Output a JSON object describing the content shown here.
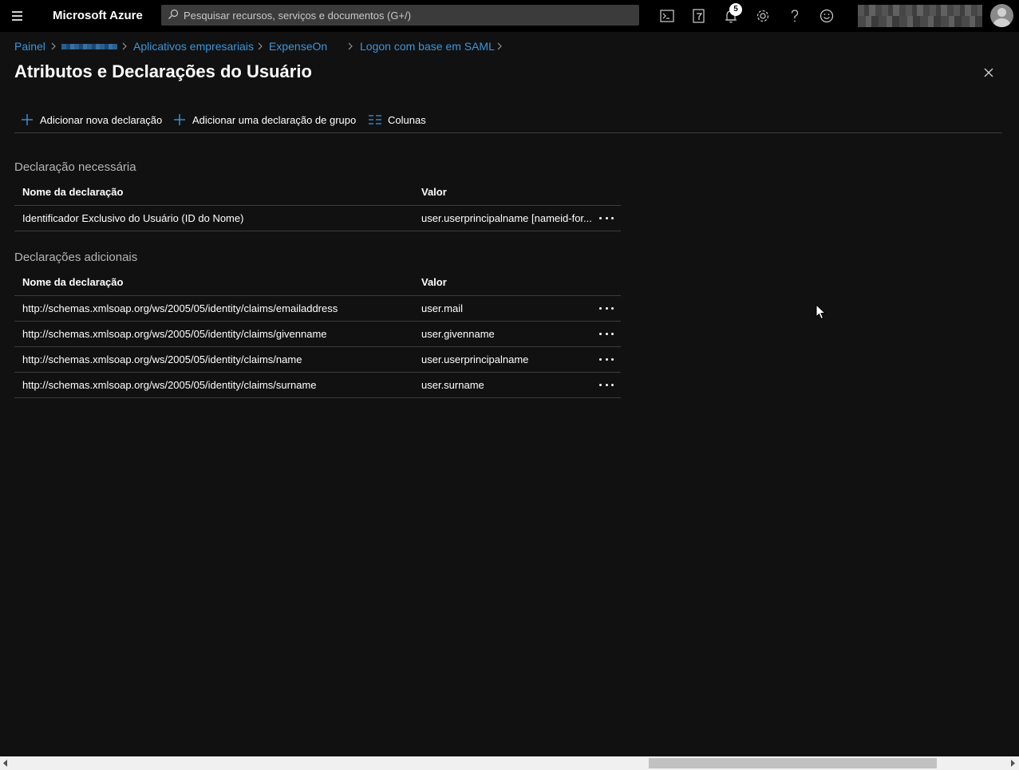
{
  "topbar": {
    "brand": "Microsoft Azure",
    "search_placeholder": "Pesquisar recursos, serviços e documentos (G+/)",
    "notification_count": "5",
    "icons": [
      "cloud-shell-icon",
      "directory-filter-icon",
      "notifications-icon",
      "settings-icon",
      "help-icon",
      "feedback-icon"
    ]
  },
  "breadcrumb": {
    "items": [
      "Painel",
      "Aplicativos empresariais",
      "ExpenseOn",
      "Logon com base em SAML"
    ]
  },
  "page": {
    "title": "Atributos e Declarações do Usuário"
  },
  "toolbar": {
    "add_claim": "Adicionar nova declaração",
    "add_group_claim": "Adicionar uma declaração de grupo",
    "columns": "Colunas"
  },
  "required": {
    "title": "Declaração necessária",
    "col_name": "Nome da declaração",
    "col_value": "Valor",
    "rows": [
      {
        "name": "Identificador Exclusivo do Usuário (ID do Nome)",
        "value": "user.userprincipalname [nameid-for..."
      }
    ]
  },
  "additional": {
    "title": "Declarações adicionais",
    "col_name": "Nome da declaração",
    "col_value": "Valor",
    "rows": [
      {
        "name": "http://schemas.xmlsoap.org/ws/2005/05/identity/claims/emailaddress",
        "value": "user.mail"
      },
      {
        "name": "http://schemas.xmlsoap.org/ws/2005/05/identity/claims/givenname",
        "value": "user.givenname"
      },
      {
        "name": "http://schemas.xmlsoap.org/ws/2005/05/identity/claims/name",
        "value": "user.userprincipalname"
      },
      {
        "name": "http://schemas.xmlsoap.org/ws/2005/05/identity/claims/surname",
        "value": "user.surname"
      }
    ]
  },
  "colors": {
    "background": "#111111",
    "topbar": "#000000",
    "link": "#3a96dd",
    "accent_icon": "#3a96dd"
  }
}
